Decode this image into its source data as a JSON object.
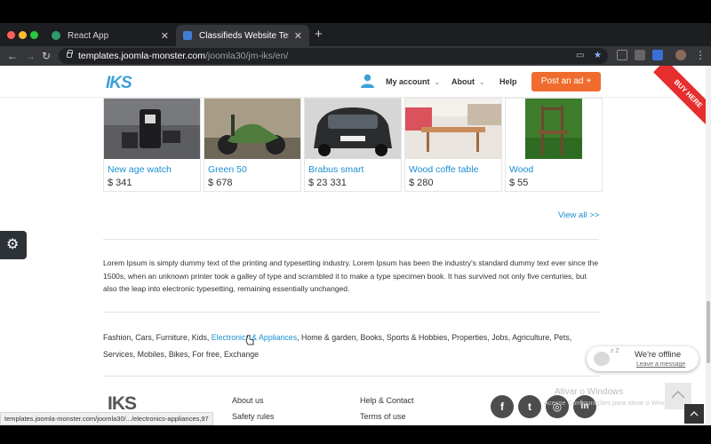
{
  "browser": {
    "tabs": [
      {
        "label": "React App",
        "favicon_color": "#2e9c6b"
      },
      {
        "label": "Classifieds Website Template -",
        "favicon_color": "#3f7fd1"
      }
    ],
    "url_host": "templates.joomla-monster.com",
    "url_path": "/joomla30/jm-iks/en/",
    "status_url": "templates.joomla-monster.com/joomla30/.../electronics-appliances,97"
  },
  "header": {
    "logo": "IKS",
    "menu": {
      "my_account": "My account",
      "about": "About",
      "help": "Help"
    },
    "post_ad": "Post an ad +",
    "ribbon": "BUY HERE"
  },
  "listings": [
    {
      "name": "New age watch",
      "price": "$ 341",
      "image": "watch-image"
    },
    {
      "name": "Green 50",
      "price": "$ 678",
      "image": "scooter-image"
    },
    {
      "name": "Brabus smart",
      "price": "$ 23 331",
      "image": "car-image"
    },
    {
      "name": "Wood coffe table",
      "price": "$ 280",
      "image": "table-image"
    },
    {
      "name": "Wood",
      "price": "$ 55",
      "image": "chair-image"
    }
  ],
  "view_all": "View all >>",
  "about_text": "Lorem Ipsum is simply dummy text of the printing and typesetting industry. Lorem Ipsum has been the industry's standard dummy text ever since the 1500s, when an unknown printer took a galley of type and scrambled it to make a type specimen book. It has survived not only five centuries, but also the leap into electronic typesetting, remaining essentially unchanged.",
  "categories": [
    {
      "label": "Fashion"
    },
    {
      "label": "Cars"
    },
    {
      "label": "Furniture"
    },
    {
      "label": "Kids"
    },
    {
      "label": "Electronics & Appliances",
      "highlight": true
    },
    {
      "label": "Home & garden"
    },
    {
      "label": "Books"
    },
    {
      "label": "Sports & Hobbies"
    },
    {
      "label": "Properties"
    },
    {
      "label": "Jobs"
    },
    {
      "label": "Agriculture"
    },
    {
      "label": "Pets"
    },
    {
      "label": "Services"
    },
    {
      "label": "Mobiles"
    },
    {
      "label": "Bikes"
    },
    {
      "label": "For free"
    },
    {
      "label": "Exchange"
    }
  ],
  "footer": {
    "logo": "IKS",
    "col1": [
      "About us",
      "Safety rules"
    ],
    "col2": [
      "Help & Contact",
      "Terms of use"
    ],
    "social": [
      {
        "icon": "facebook-icon",
        "glyph": "f"
      },
      {
        "icon": "twitter-icon",
        "glyph": "t"
      },
      {
        "icon": "instagram-icon",
        "glyph": "◎"
      },
      {
        "icon": "linkedin-icon",
        "glyph": "in"
      }
    ]
  },
  "chat": {
    "status": "We're offline",
    "action": "Leave a message",
    "z": "z Z"
  },
  "windows_watermark": {
    "line1": "Ativar o Windows",
    "line2": "Acesse Configurações para ativar o Windows."
  },
  "colors": {
    "accent": "#1a8fd0",
    "cta": "#ef6c2e",
    "ribbon": "#e62e2e"
  }
}
